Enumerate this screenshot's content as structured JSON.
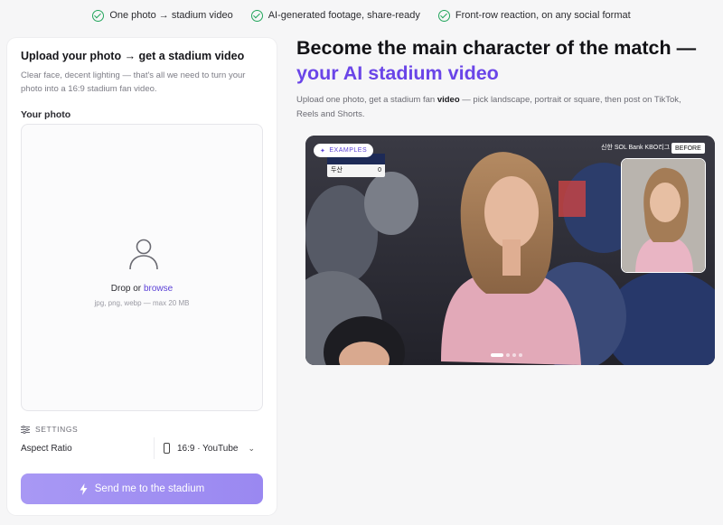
{
  "features": [
    {
      "label": "One photo → stadium video",
      "icon": "check-circle-icon"
    },
    {
      "label": "AI-generated footage, share-ready",
      "icon": "check-circle-icon"
    },
    {
      "label": "Front-row reaction, on any social format",
      "icon": "check-circle-icon"
    }
  ],
  "upload": {
    "title": "Upload your photo → get a stadium video",
    "description": "Clear face, decent lighting — that's all we need to turn your photo into a 16:9 stadium fan video.",
    "photo_label": "Your photo",
    "drop_prefix": "Drop or",
    "browse_label": "browse",
    "hint": "jpg, png, webp — max 20 MB",
    "settings_label": "SETTINGS",
    "aspect_ratio_label": "Aspect Ratio",
    "aspect_ratio_value": "16:9 · YouTube",
    "cta_label": "Send me to the stadium"
  },
  "hero": {
    "title": "Become the main character of the match —",
    "title_accent": "your AI stadium video",
    "subtitle_prefix": "Upload one photo, get a stadium fan",
    "subtitle_bold": "video",
    "subtitle_suffix": "— pick landscape, portrait or square, then post on TikTok, Reels and Shorts."
  },
  "media": {
    "examples_label": "EXAMPLES",
    "before_label": "BEFORE",
    "broadcast_text": "신한 SOL Bank KBO리그",
    "scoreboard": {
      "row1_team": "",
      "row1_score": "",
      "row2_team": "두산",
      "row2_score": "0"
    },
    "carousel_active_index": 0,
    "carousel_count": 4
  },
  "colors": {
    "accent": "#6a45e8",
    "cta": "#9f8ff3",
    "check": "#22a55b"
  }
}
